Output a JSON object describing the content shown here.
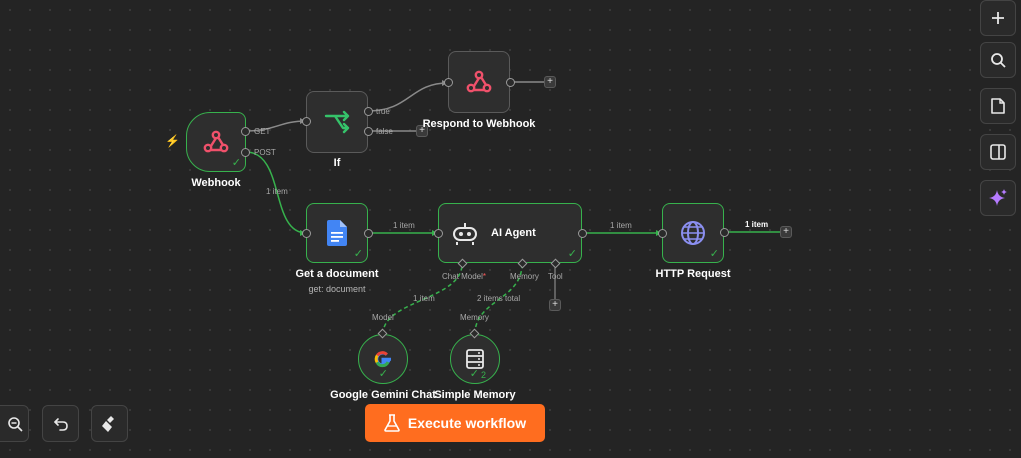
{
  "nodes": {
    "webhook": {
      "label": "Webhook"
    },
    "if": {
      "label": "If"
    },
    "respond": {
      "label": "Respond to Webhook"
    },
    "get_document": {
      "label": "Get a document",
      "subtitle": "get: document"
    },
    "ai_agent": {
      "label": "AI Agent"
    },
    "http_request": {
      "label": "HTTP Request"
    },
    "gemini": {
      "label": "Google Gemini Chat"
    },
    "memory": {
      "label": "Simple Memory",
      "badge": "2"
    }
  },
  "ports": {
    "webhook_get": "GET",
    "webhook_post": "POST",
    "if_true": "true",
    "if_false": "false",
    "agent_chat_model": "Chat Model",
    "agent_chat_model_required": "*",
    "agent_memory": "Memory",
    "agent_tool": "Tool",
    "gemini_model": "Model",
    "memory_memory": "Memory"
  },
  "edge_labels": {
    "post_to_doc": "1 item",
    "doc_to_agent": "1 item",
    "agent_to_http": "1 item",
    "http_out": "1 item",
    "gemini_to_agent": "1 item",
    "memory_to_agent": "2 items total"
  },
  "toolbar": {
    "execute_label": "Execute workflow"
  },
  "icons": {
    "webhook": "webhook-icon",
    "if": "branch-icon",
    "get_document": "google-docs-icon",
    "ai_agent": "robot-icon",
    "http_request": "globe-icon",
    "gemini": "google-icon",
    "memory": "database-icon",
    "right_toolbar": [
      "plus-icon",
      "search-icon",
      "sticky-note-icon",
      "panel-icon",
      "sparkles-icon"
    ],
    "bottom_left": [
      "zoom-out-icon",
      "undo-icon",
      "clear-icon"
    ],
    "execute": "flask-icon",
    "trigger": "lightning-icon"
  },
  "colors": {
    "accent": "#ff6d1f",
    "success": "#37b24d",
    "webhook_pink": "#f0516b",
    "if_green": "#35c36a",
    "docs_blue": "#4285f4",
    "globe_purple": "#8b8ff0",
    "sparkle_purple": "#b57bff"
  }
}
